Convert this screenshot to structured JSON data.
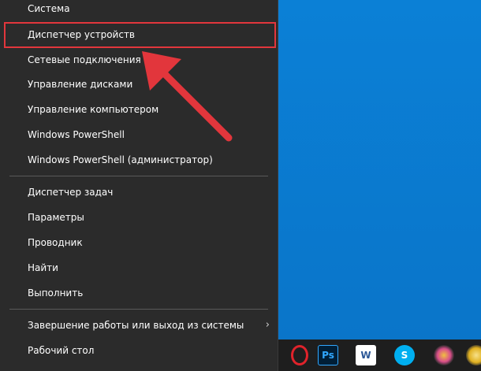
{
  "menu": {
    "items": [
      {
        "label": "Система"
      },
      {
        "label": "Диспетчер устройств"
      },
      {
        "label": "Сетевые подключения"
      },
      {
        "label": "Управление дисками"
      },
      {
        "label": "Управление компьютером"
      },
      {
        "label": "Windows PowerShell"
      },
      {
        "label": "Windows PowerShell (администратор)"
      },
      {
        "label": "Диспетчер задач"
      },
      {
        "label": "Параметры"
      },
      {
        "label": "Проводник"
      },
      {
        "label": "Найти"
      },
      {
        "label": "Выполнить"
      },
      {
        "label": "Завершение работы или выход из системы"
      },
      {
        "label": "Рабочий стол"
      }
    ]
  },
  "taskbar": {
    "icons": [
      {
        "name": "opera-icon",
        "glyph": "O",
        "color": "#e0232b"
      },
      {
        "name": "photoshop-icon",
        "glyph": "Ps",
        "color": "#31a8ff"
      },
      {
        "name": "word-icon",
        "glyph": "W",
        "color": "#2b5797"
      },
      {
        "name": "skype-icon",
        "glyph": "S",
        "color": "#00aff0"
      },
      {
        "name": "app-icon",
        "glyph": "",
        "color": "#d94f8a"
      },
      {
        "name": "app2-icon",
        "glyph": "",
        "color": "#e0b020"
      }
    ]
  },
  "colors": {
    "highlight": "#e2363c",
    "menu_bg": "#2b2b2b",
    "desktop": "#0a7bd1"
  }
}
